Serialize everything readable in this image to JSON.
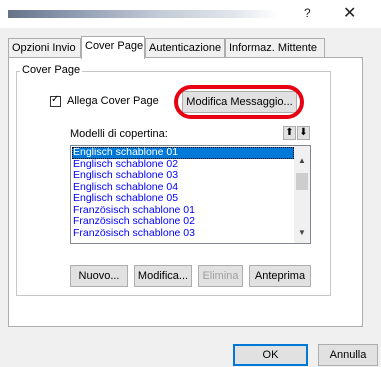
{
  "window": {
    "help_glyph": "?",
    "close_glyph": "✕"
  },
  "tabs": [
    {
      "label": "Opzioni Invio",
      "active": false
    },
    {
      "label": "Cover Page",
      "active": true
    },
    {
      "label": "Autenticazione",
      "active": false
    },
    {
      "label": "Informaz. Mittente",
      "active": false
    }
  ],
  "cover_page": {
    "group_title": "Cover Page",
    "attach_checkbox": {
      "label": "Allega Cover Page",
      "checked": true
    },
    "edit_message_button": "Modifica Messaggio...",
    "templates_label": "Modelli di copertina:",
    "sort_up_glyph": "⬆",
    "sort_down_glyph": "⬇",
    "templates": [
      "Englisch schablone 01",
      "Englisch schablone 02",
      "Englisch schablone 03",
      "Englisch schablone 04",
      "Englisch schablone 05",
      "Französisch schablone 01",
      "Französisch schablone 02",
      "Französisch schablone 03"
    ],
    "selected_template": "Englisch schablone 01",
    "actions": {
      "new": "Nuovo...",
      "edit": "Modifica...",
      "delete": "Elimina",
      "preview": "Anteprima"
    }
  },
  "footer": {
    "ok": "OK",
    "cancel": "Annulla"
  },
  "colors": {
    "highlight_ring": "#e60012",
    "selection": "#0078d7",
    "list_text": "#0000ff"
  }
}
